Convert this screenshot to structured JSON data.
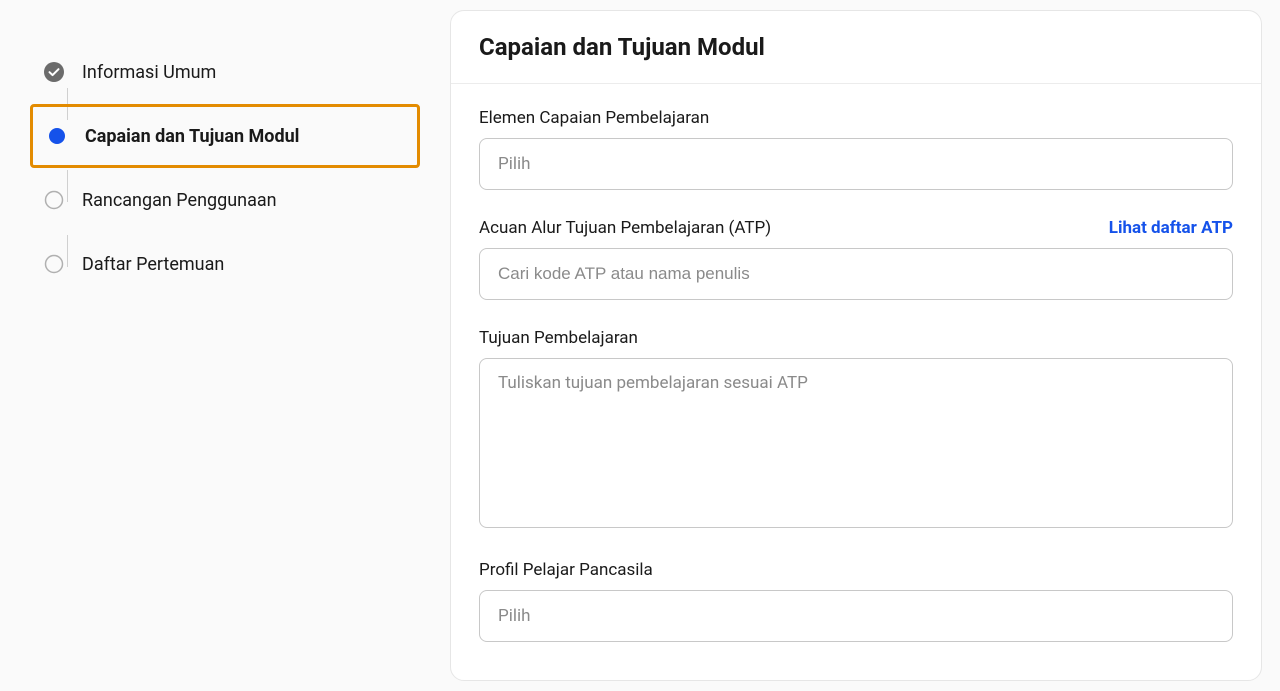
{
  "sidebar": {
    "steps": [
      {
        "label": "Informasi Umum",
        "status": "completed"
      },
      {
        "label": "Capaian dan Tujuan Modul",
        "status": "active"
      },
      {
        "label": "Rancangan Penggunaan",
        "status": "pending"
      },
      {
        "label": "Daftar Pertemuan",
        "status": "pending"
      }
    ]
  },
  "card": {
    "title": "Capaian dan Tujuan Modul"
  },
  "fields": {
    "elemen": {
      "label": "Elemen Capaian Pembelajaran",
      "placeholder": "Pilih"
    },
    "atp": {
      "label": "Acuan Alur Tujuan Pembelajaran (ATP)",
      "link": "Lihat daftar ATP",
      "placeholder": "Cari kode ATP atau nama penulis"
    },
    "tujuan": {
      "label": "Tujuan Pembelajaran",
      "placeholder": "Tuliskan tujuan pembelajaran sesuai ATP"
    },
    "profil": {
      "label": "Profil Pelajar Pancasila",
      "placeholder": "Pilih"
    }
  },
  "colors": {
    "accent": "#1552ea",
    "highlight": "#e38b00"
  }
}
